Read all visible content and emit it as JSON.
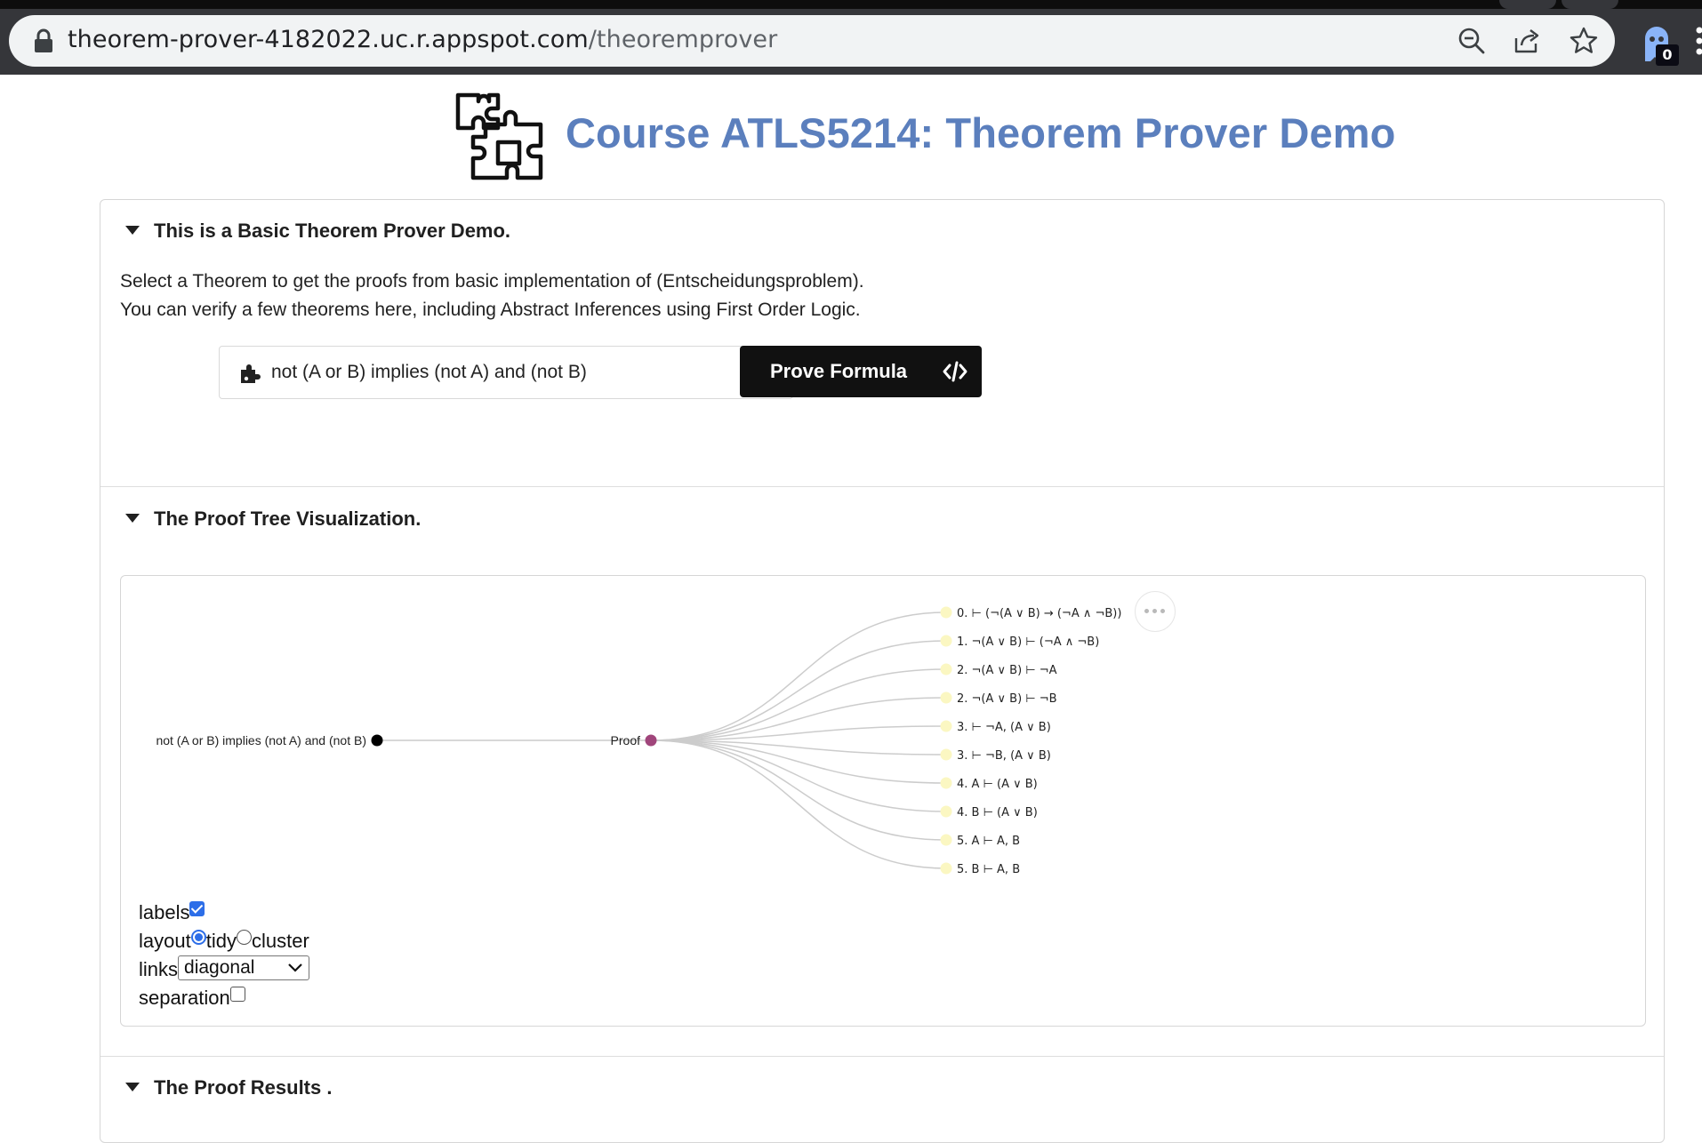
{
  "browser": {
    "url_host": "theorem-prover-4182022.uc.r.appspot.com",
    "url_path": "/theoremprover",
    "extension_badge": "0",
    "icons": [
      "lock-icon",
      "zoom-out-icon",
      "share-icon",
      "bookmark-star-icon",
      "ghost-extension-icon",
      "menu-dots-icon"
    ]
  },
  "page": {
    "title": "Course ATLS5214: Theorem Prover Demo",
    "logo_icon": "puzzle-pieces-icon",
    "title_color": "#5b7fbd"
  },
  "section1": {
    "heading": "This is a Basic Theorem Prover Demo.",
    "line1": "Select a Theorem to get the proofs from basic implementation of (Entscheidungsproblem).",
    "line2": "You can verify a few theorems here, including Abstract Inferences using First Order Logic.",
    "formula_value": "not (A or B) implies (not A) and (not B)",
    "prove_label": "Prove Formula"
  },
  "section2": {
    "heading": "The Proof Tree Visualization.",
    "tree": {
      "root_label": "not (A or B) implies (not A) and (not B)",
      "proof_label": "Proof",
      "leaves": [
        "0. ⊢ (¬(A ∨ B) → (¬A ∧ ¬B))",
        "1. ¬(A ∨ B) ⊢ (¬A ∧ ¬B)",
        "2. ¬(A ∨ B) ⊢ ¬A",
        "2. ¬(A ∨ B) ⊢ ¬B",
        "3. ⊢ ¬A, (A ∨ B)",
        "3. ⊢ ¬B, (A ∨ B)",
        "4. A ⊢ (A ∨ B)",
        "4. B ⊢ (A ∨ B)",
        "5. A ⊢ A, B",
        "5. B ⊢ A, B"
      ],
      "colors": {
        "root": "#000000",
        "proof": "#a0457b",
        "leaf": "#fbf7c2",
        "link": "#cccccc"
      }
    },
    "controls": {
      "labels_label": "labels",
      "labels_checked": true,
      "layout_label": "layout",
      "layout_options": [
        "tidy",
        "cluster"
      ],
      "layout_selected": "tidy",
      "links_label": "links",
      "links_value": "diagonal",
      "separation_label": "separation",
      "separation_checked": false
    }
  },
  "section3": {
    "heading": "The Proof Results ."
  }
}
